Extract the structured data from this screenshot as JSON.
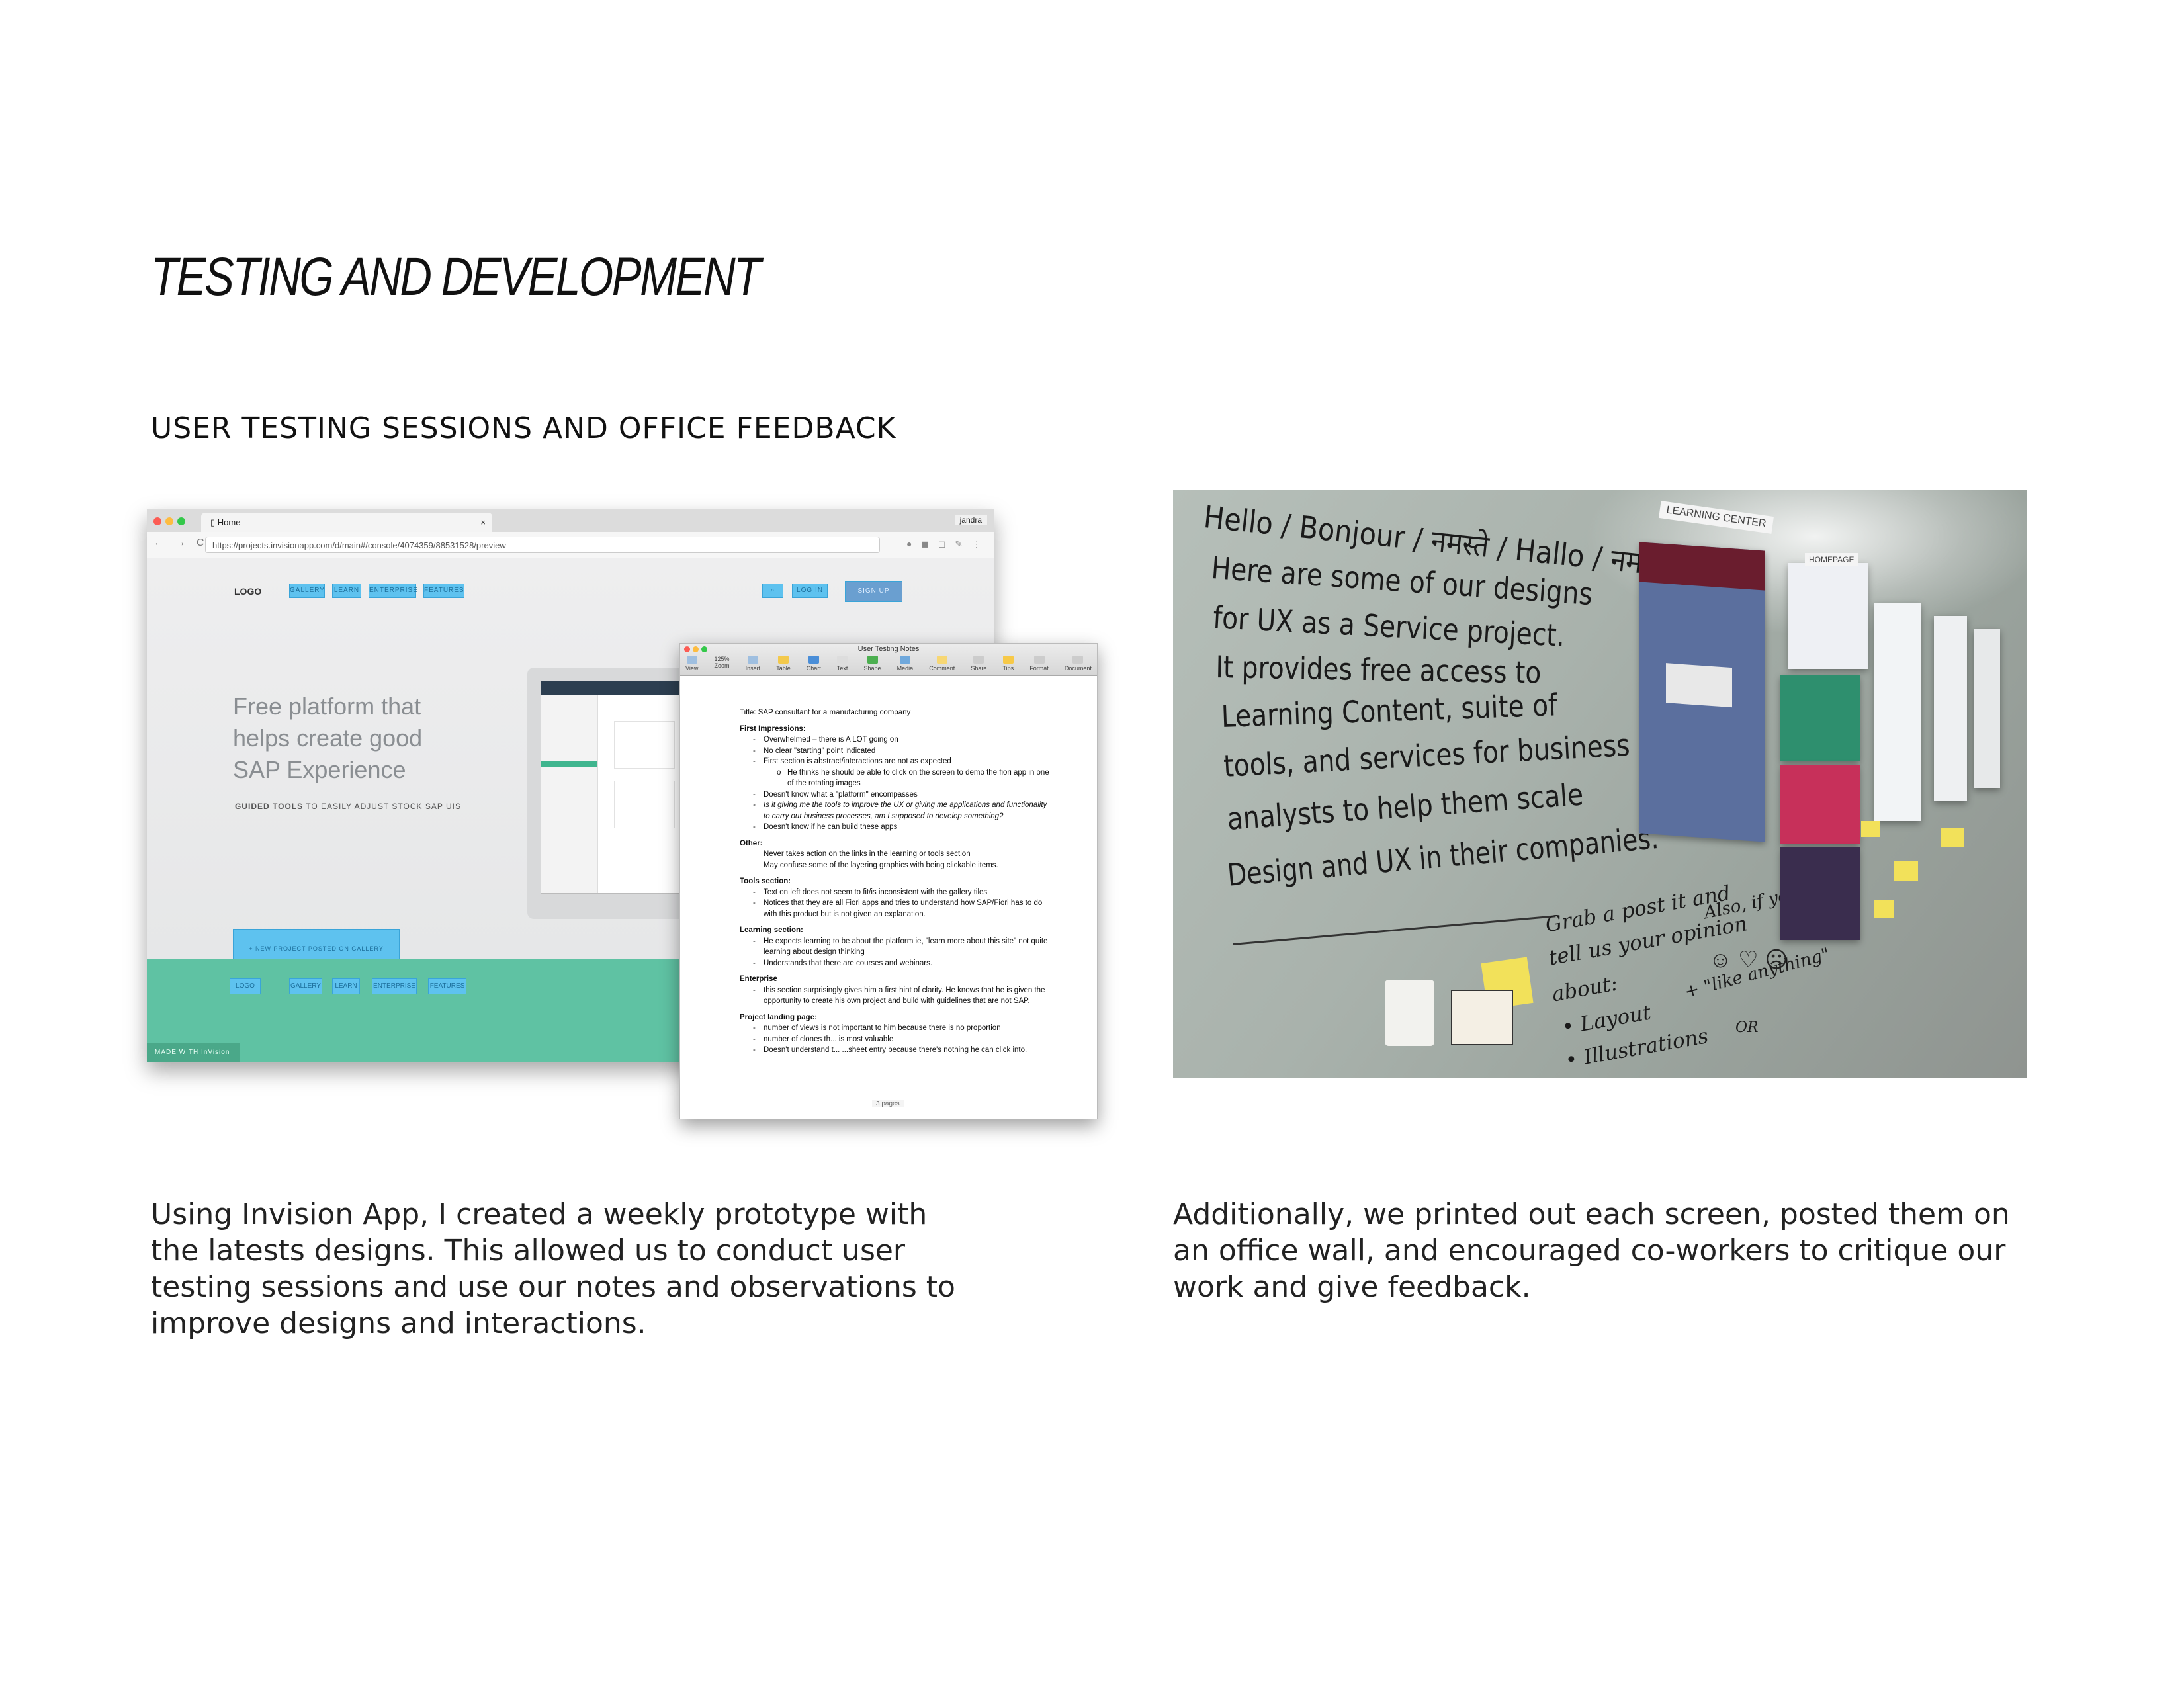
{
  "page": {
    "title": "TESTING AND DEVELOPMENT",
    "section_title": "USER TESTING SESSIONS AND OFFICE FEEDBACK",
    "caption_left": "Using Invision App, I created a weekly prototype with the latests designs. This allowed us to conduct user testing sessions and use our notes and observations to improve designs and interactions.",
    "caption_right": "Additionally, we printed out each screen, posted them on an office wall, and encouraged co-workers to critique our work and give feedback."
  },
  "browser": {
    "tab_title": "Home",
    "tab_close": "×",
    "user": "jandra",
    "url": "https://projects.invisionapp.com/d/main#/console/4074359/88531528/preview",
    "nav_glyphs": "← → C",
    "site": {
      "logo": "LOGO",
      "nav": [
        "GALLERY",
        "LEARN",
        "ENTERPRISE",
        "FEATURES"
      ],
      "login": "LOG IN",
      "signup": "SIGN UP",
      "hero_line1": "Free platform that",
      "hero_line2": "helps create good",
      "hero_line3": "SAP Experience",
      "guided": "GUIDED TOOLS",
      "guided_rest": " TO EASILY ADJUST STOCK SAP UIS",
      "new_project": "+ NEW PROJECT POSTED ON GALLERY",
      "footer_logo": "LOGO",
      "footer_nav": [
        "GALLERY",
        "LEARN",
        "ENTERPRISE",
        "FEATURES"
      ],
      "made_with": "MADE WITH InVision"
    }
  },
  "doc": {
    "window_title": "User Testing Notes",
    "toolbar": [
      "View",
      "Zoom",
      "Insert",
      "Table",
      "Chart",
      "Text",
      "Shape",
      "Media",
      "Comment",
      "Share",
      "Tips",
      "Format",
      "Document"
    ],
    "zoom": "125%",
    "title_line": "Title: SAP consultant for a manufacturing company",
    "first_impressions": "First Impressions:",
    "fi_1": "Overwhelmed – there is A LOT going on",
    "fi_2": "No clear \"starting\" point indicated",
    "fi_3": "First section is abstract/interactions are not as expected",
    "fi_3a": "He thinks he should be able to click on the screen to demo the fiori app in one of the rotating images",
    "fi_4": "Doesn't know what a \"platform\" encompasses",
    "fi_5": "Is it giving me the tools to improve the UX or giving me applications and functionality to carry out business processes, am I supposed to develop something?",
    "fi_6": "Doesn't know if he can build these apps",
    "other": "Other:",
    "other_1": "Never takes action on the links in the learning or tools section",
    "other_2": "May confuse some of the layering graphics with being clickable items.",
    "tools": "Tools section:",
    "tools_1": "Text on left does not seem to fit/is inconsistent with the gallery tiles",
    "tools_2": "Notices that they are all Fiori apps and tries to understand how SAP/Fiori has to do with this product but is not given an explanation.",
    "learning": "Learning section:",
    "learning_1": "He expects learning to be about the platform ie, \"learn more about this site\" not quite learning about design thinking",
    "learning_2": "Understands that there are courses and webinars.",
    "enterprise": "Enterprise",
    "enterprise_1": "this section surprisingly gives him a first hint of clarity. He knows that he is given the opportunity to create his own project and build with guidelines that are not SAP.",
    "landing": "Project landing page:",
    "landing_1": "number of views is not important to him because there is no proportion",
    "landing_2": "number of clones th... is most valuable",
    "landing_3": "Doesn't understand t... ...sheet entry because there's nothing he can click into.",
    "page_indicator": "3 pages"
  },
  "whiteboard": {
    "line1": "Hello / Bonjour / नमस्ते / Hallo / नमस्ते",
    "line2": "Here are some of our designs",
    "line3": "for UX as a Service project.",
    "line4": "It provides free access to",
    "line5": "Learning Content, suite of",
    "line6": "tools, and services for business",
    "line7": "analysts to help them scale",
    "line8": "Design and UX in their companies.",
    "grab1": "Grab a post it and",
    "grab2": "tell us your opinion",
    "grab3": "about:",
    "grab4": "• Layout",
    "grab5": "• Illustrations",
    "also": "Also, if you",
    "like": "+ \"like anything\"",
    "or": "OR",
    "poster_label1": "LEARNING CENTER",
    "poster_label2": "HOMEPAGE"
  }
}
